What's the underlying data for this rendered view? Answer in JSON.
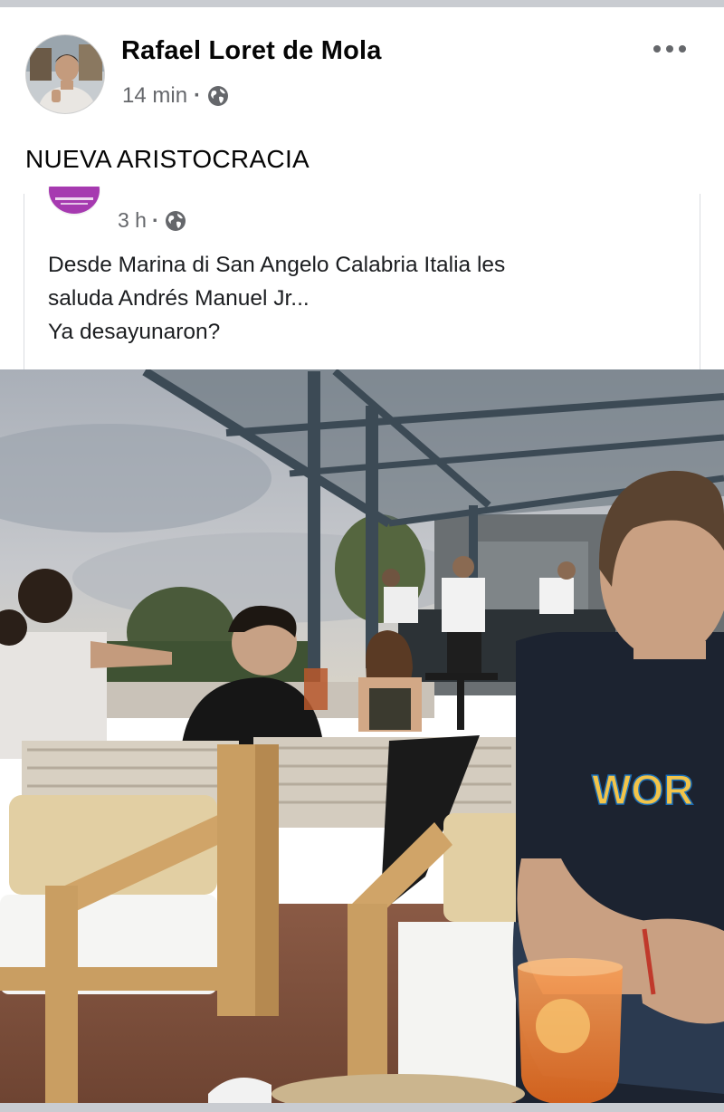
{
  "post": {
    "author_name": "Rafael Loret de Mola",
    "time": "14 min",
    "separator": "·",
    "privacy_icon": "globe-icon",
    "more_icon": "more-options-icon",
    "caption": "NUEVA ARISTOCRACIA"
  },
  "shared_post": {
    "time": "3 h",
    "separator": "·",
    "privacy_icon": "globe-icon",
    "text_lines": [
      "Desde Marina di San Angelo Calabria Italia les",
      "saluda Andrés Manuel Jr...",
      "Ya desayunaron?"
    ]
  },
  "photo": {
    "shirt_text": "WOR"
  },
  "colors": {
    "text_primary": "#050505",
    "text_secondary": "#65676b",
    "divider": "#c9ccd1",
    "shared_avatar_accent": "#a63ab0"
  }
}
